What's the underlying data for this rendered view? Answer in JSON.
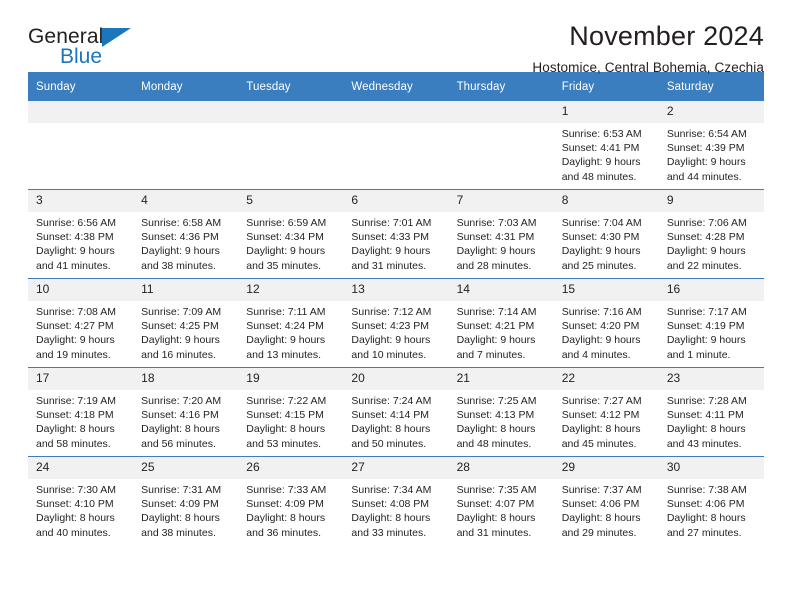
{
  "logo": {
    "word_top": "General",
    "word_bottom": "Blue",
    "triangle_color": "#1c76bc",
    "text_color": "#231f20"
  },
  "header": {
    "title": "November 2024",
    "subtitle": "Hostomice, Central Bohemia, Czechia"
  },
  "theme": {
    "header_blue": "#3a7ec0",
    "daynum_gray": "#f1f1f1",
    "text": "#231f20"
  },
  "weekdays": [
    "Sunday",
    "Monday",
    "Tuesday",
    "Wednesday",
    "Thursday",
    "Friday",
    "Saturday"
  ],
  "weeks": [
    [
      {
        "day": "",
        "sunrise": "",
        "sunset": "",
        "daylight1": "",
        "daylight2": ""
      },
      {
        "day": "",
        "sunrise": "",
        "sunset": "",
        "daylight1": "",
        "daylight2": ""
      },
      {
        "day": "",
        "sunrise": "",
        "sunset": "",
        "daylight1": "",
        "daylight2": ""
      },
      {
        "day": "",
        "sunrise": "",
        "sunset": "",
        "daylight1": "",
        "daylight2": ""
      },
      {
        "day": "",
        "sunrise": "",
        "sunset": "",
        "daylight1": "",
        "daylight2": ""
      },
      {
        "day": "1",
        "sunrise": "Sunrise: 6:53 AM",
        "sunset": "Sunset: 4:41 PM",
        "daylight1": "Daylight: 9 hours",
        "daylight2": "and 48 minutes."
      },
      {
        "day": "2",
        "sunrise": "Sunrise: 6:54 AM",
        "sunset": "Sunset: 4:39 PM",
        "daylight1": "Daylight: 9 hours",
        "daylight2": "and 44 minutes."
      }
    ],
    [
      {
        "day": "3",
        "sunrise": "Sunrise: 6:56 AM",
        "sunset": "Sunset: 4:38 PM",
        "daylight1": "Daylight: 9 hours",
        "daylight2": "and 41 minutes."
      },
      {
        "day": "4",
        "sunrise": "Sunrise: 6:58 AM",
        "sunset": "Sunset: 4:36 PM",
        "daylight1": "Daylight: 9 hours",
        "daylight2": "and 38 minutes."
      },
      {
        "day": "5",
        "sunrise": "Sunrise: 6:59 AM",
        "sunset": "Sunset: 4:34 PM",
        "daylight1": "Daylight: 9 hours",
        "daylight2": "and 35 minutes."
      },
      {
        "day": "6",
        "sunrise": "Sunrise: 7:01 AM",
        "sunset": "Sunset: 4:33 PM",
        "daylight1": "Daylight: 9 hours",
        "daylight2": "and 31 minutes."
      },
      {
        "day": "7",
        "sunrise": "Sunrise: 7:03 AM",
        "sunset": "Sunset: 4:31 PM",
        "daylight1": "Daylight: 9 hours",
        "daylight2": "and 28 minutes."
      },
      {
        "day": "8",
        "sunrise": "Sunrise: 7:04 AM",
        "sunset": "Sunset: 4:30 PM",
        "daylight1": "Daylight: 9 hours",
        "daylight2": "and 25 minutes."
      },
      {
        "day": "9",
        "sunrise": "Sunrise: 7:06 AM",
        "sunset": "Sunset: 4:28 PM",
        "daylight1": "Daylight: 9 hours",
        "daylight2": "and 22 minutes."
      }
    ],
    [
      {
        "day": "10",
        "sunrise": "Sunrise: 7:08 AM",
        "sunset": "Sunset: 4:27 PM",
        "daylight1": "Daylight: 9 hours",
        "daylight2": "and 19 minutes."
      },
      {
        "day": "11",
        "sunrise": "Sunrise: 7:09 AM",
        "sunset": "Sunset: 4:25 PM",
        "daylight1": "Daylight: 9 hours",
        "daylight2": "and 16 minutes."
      },
      {
        "day": "12",
        "sunrise": "Sunrise: 7:11 AM",
        "sunset": "Sunset: 4:24 PM",
        "daylight1": "Daylight: 9 hours",
        "daylight2": "and 13 minutes."
      },
      {
        "day": "13",
        "sunrise": "Sunrise: 7:12 AM",
        "sunset": "Sunset: 4:23 PM",
        "daylight1": "Daylight: 9 hours",
        "daylight2": "and 10 minutes."
      },
      {
        "day": "14",
        "sunrise": "Sunrise: 7:14 AM",
        "sunset": "Sunset: 4:21 PM",
        "daylight1": "Daylight: 9 hours",
        "daylight2": "and 7 minutes."
      },
      {
        "day": "15",
        "sunrise": "Sunrise: 7:16 AM",
        "sunset": "Sunset: 4:20 PM",
        "daylight1": "Daylight: 9 hours",
        "daylight2": "and 4 minutes."
      },
      {
        "day": "16",
        "sunrise": "Sunrise: 7:17 AM",
        "sunset": "Sunset: 4:19 PM",
        "daylight1": "Daylight: 9 hours",
        "daylight2": "and 1 minute."
      }
    ],
    [
      {
        "day": "17",
        "sunrise": "Sunrise: 7:19 AM",
        "sunset": "Sunset: 4:18 PM",
        "daylight1": "Daylight: 8 hours",
        "daylight2": "and 58 minutes."
      },
      {
        "day": "18",
        "sunrise": "Sunrise: 7:20 AM",
        "sunset": "Sunset: 4:16 PM",
        "daylight1": "Daylight: 8 hours",
        "daylight2": "and 56 minutes."
      },
      {
        "day": "19",
        "sunrise": "Sunrise: 7:22 AM",
        "sunset": "Sunset: 4:15 PM",
        "daylight1": "Daylight: 8 hours",
        "daylight2": "and 53 minutes."
      },
      {
        "day": "20",
        "sunrise": "Sunrise: 7:24 AM",
        "sunset": "Sunset: 4:14 PM",
        "daylight1": "Daylight: 8 hours",
        "daylight2": "and 50 minutes."
      },
      {
        "day": "21",
        "sunrise": "Sunrise: 7:25 AM",
        "sunset": "Sunset: 4:13 PM",
        "daylight1": "Daylight: 8 hours",
        "daylight2": "and 48 minutes."
      },
      {
        "day": "22",
        "sunrise": "Sunrise: 7:27 AM",
        "sunset": "Sunset: 4:12 PM",
        "daylight1": "Daylight: 8 hours",
        "daylight2": "and 45 minutes."
      },
      {
        "day": "23",
        "sunrise": "Sunrise: 7:28 AM",
        "sunset": "Sunset: 4:11 PM",
        "daylight1": "Daylight: 8 hours",
        "daylight2": "and 43 minutes."
      }
    ],
    [
      {
        "day": "24",
        "sunrise": "Sunrise: 7:30 AM",
        "sunset": "Sunset: 4:10 PM",
        "daylight1": "Daylight: 8 hours",
        "daylight2": "and 40 minutes."
      },
      {
        "day": "25",
        "sunrise": "Sunrise: 7:31 AM",
        "sunset": "Sunset: 4:09 PM",
        "daylight1": "Daylight: 8 hours",
        "daylight2": "and 38 minutes."
      },
      {
        "day": "26",
        "sunrise": "Sunrise: 7:33 AM",
        "sunset": "Sunset: 4:09 PM",
        "daylight1": "Daylight: 8 hours",
        "daylight2": "and 36 minutes."
      },
      {
        "day": "27",
        "sunrise": "Sunrise: 7:34 AM",
        "sunset": "Sunset: 4:08 PM",
        "daylight1": "Daylight: 8 hours",
        "daylight2": "and 33 minutes."
      },
      {
        "day": "28",
        "sunrise": "Sunrise: 7:35 AM",
        "sunset": "Sunset: 4:07 PM",
        "daylight1": "Daylight: 8 hours",
        "daylight2": "and 31 minutes."
      },
      {
        "day": "29",
        "sunrise": "Sunrise: 7:37 AM",
        "sunset": "Sunset: 4:06 PM",
        "daylight1": "Daylight: 8 hours",
        "daylight2": "and 29 minutes."
      },
      {
        "day": "30",
        "sunrise": "Sunrise: 7:38 AM",
        "sunset": "Sunset: 4:06 PM",
        "daylight1": "Daylight: 8 hours",
        "daylight2": "and 27 minutes."
      }
    ]
  ]
}
